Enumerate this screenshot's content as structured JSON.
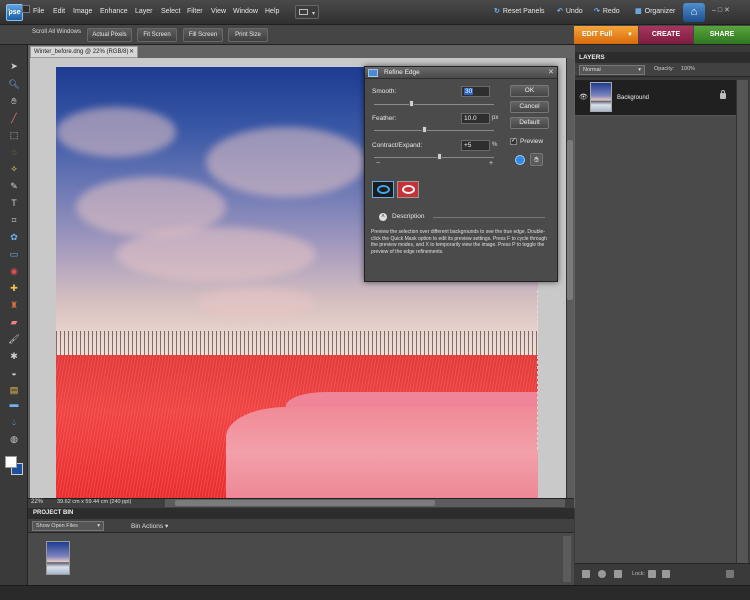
{
  "app": {
    "logo": "pse",
    "menus": [
      "File",
      "Edit",
      "Image",
      "Enhance",
      "Layer",
      "Select",
      "Filter",
      "View",
      "Window",
      "Help"
    ],
    "reset_panels": "Reset Panels",
    "undo": "Undo",
    "redo": "Redo",
    "organizer": "Organizer"
  },
  "options_bar": {
    "scroll_all_windows": "Scroll All Windows",
    "actual_pixels": "Actual Pixels",
    "fit_screen": "Fit Screen",
    "fill_screen": "Fill Screen",
    "print_size": "Print Size"
  },
  "mode_tabs": {
    "edit": "EDIT Full",
    "create": "CREATE",
    "share": "SHARE",
    "colors": {
      "edit": "#e98418",
      "create": "#8f2650",
      "share": "#3f8c2c"
    }
  },
  "document": {
    "tab_title": "Winter_before.dng @ 22% (RGB/8)",
    "zoom": "22%",
    "size": "39.62 cm x 59.44 cm (240 ppi)"
  },
  "project_bin": {
    "title": "PROJECT BIN",
    "show": "Show Open Files",
    "actions": "Bin Actions"
  },
  "layers": {
    "title": "LAYERS",
    "blend_mode": "Normal",
    "opacity_label": "Opacity:",
    "opacity_value": "100%",
    "items": [
      {
        "name": "Background"
      }
    ],
    "lock_label": "Lock:"
  },
  "refine_edge": {
    "title": "Refine Edge",
    "smooth_label": "Smooth:",
    "smooth_value": "30",
    "feather_label": "Feather:",
    "feather_value": "10.0",
    "feather_unit": "px",
    "contract_label": "Contract/Expand:",
    "contract_value": "+5",
    "contract_unit": "%",
    "minus": "−",
    "plus": "+",
    "ok": "OK",
    "cancel": "Cancel",
    "default": "Default",
    "preview_label": "Preview",
    "preview_checked": true,
    "description_label": "Description",
    "description_text": "Preview the selection over different backgrounds to see the true edge. Double-click the Quick Mask option to edit its preview settings. Press F to cycle through the preview modes, and X to temporarily view the image. Press P to toggle the preview of the edge refinements."
  },
  "icons": {
    "tools": [
      "move-icon",
      "zoom-icon",
      "hand-icon",
      "eyedropper-icon",
      "marquee-icon",
      "lasso-icon",
      "magic-wand-icon",
      "selection-brush-icon",
      "type-icon",
      "crop-icon",
      "cookie-cutter-icon",
      "straighten-icon",
      "red-eye-icon",
      "healing-brush-icon",
      "clone-stamp-icon",
      "eraser-icon",
      "brush-icon",
      "smart-brush-icon",
      "paint-bucket-icon",
      "gradient-icon",
      "shape-icon",
      "blur-icon",
      "sponge-icon"
    ]
  }
}
